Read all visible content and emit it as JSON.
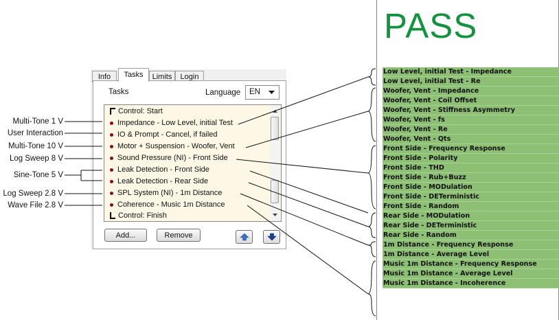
{
  "annotations": [
    "Multi-Tone 1 V",
    "User Interaction",
    "Multi-Tone 10 V",
    "Log Sweep 8 V",
    "Sine-Tone 5 V",
    "Log Sweep 2.8 V",
    "Wave File 2.8 V"
  ],
  "tabs": [
    "Info",
    "Tasks",
    "Limits",
    "Login"
  ],
  "panel": {
    "title": "Tasks",
    "language_label": "Language",
    "language_value": "EN"
  },
  "tasks": [
    "Control: Start",
    "Impedance - Low Level, initial Test",
    "IO & Prompt - Cancel, if failed",
    "Motor + Suspension - Woofer, Vent",
    "Sound Pressure (NI) - Front Side",
    "Leak Detection - Front Side",
    "Leak Detection - Rear Side",
    "SPL System (NI) - 1m Distance",
    "Coherence - Music 1m Distance",
    "Control: Finish"
  ],
  "buttons": {
    "add": "Add...",
    "remove": "Remove"
  },
  "result": {
    "status": "PASS",
    "color": "#15923f",
    "row_color": "#8dbf74",
    "items": [
      "Low Level, initial Test - Impedance",
      "Low Level, initial Test - Re",
      "Woofer, Vent - Impedance",
      "Woofer, Vent - Coil Offset",
      "Woofer, Vent - Stiffness Asymmetry",
      "Woofer, Vent - fs",
      "Woofer, Vent - Re",
      "Woofer, Vent - Qts",
      "Front Side - Frequency Response",
      "Front Side - Polarity",
      "Front Side - THD",
      "Front Side - Rub+Buzz",
      "Front Side - MODulation",
      "Front Side - DETerministic",
      "Front Side - Random",
      "Rear Side - MODulation",
      "Rear Side - DETerministic",
      "Rear Side - Random",
      "1m Distance - Frequency Response",
      "1m Distance - Average Level",
      "Music 1m Distance - Frequency Response",
      "Music 1m Distance - Average Level",
      "Music 1m Distance - Incoherence"
    ]
  }
}
